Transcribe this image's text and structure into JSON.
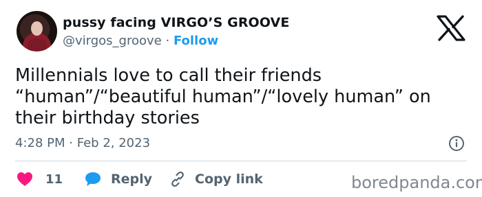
{
  "author": {
    "display_name": "pussy facing VIRGO’S GROOVE",
    "handle": "@virgos_groove",
    "separator": "·",
    "follow_label": "Follow"
  },
  "tweet": {
    "text_lines": [
      "Millennials love to call their friends",
      "“human”/“beautiful human”/“lovely human” on",
      "their birthday stories"
    ],
    "time": "4:28 PM",
    "date_separator": "·",
    "date": "Feb 2, 2023"
  },
  "actions": {
    "like_count": "11",
    "reply_label": "Reply",
    "copy_link_label": "Copy link"
  },
  "watermark": "boredpanda.com",
  "colors": {
    "text": "#0f1419",
    "secondary": "#536471",
    "link": "#1d9bf0",
    "like": "#f91880",
    "reply": "#1d9bf0",
    "divider": "#cfd9de"
  },
  "icons": {
    "x_logo": "x-logo-icon",
    "info": "info-icon",
    "like": "heart-icon",
    "reply": "speech-bubble-icon",
    "copy_link": "link-icon"
  }
}
